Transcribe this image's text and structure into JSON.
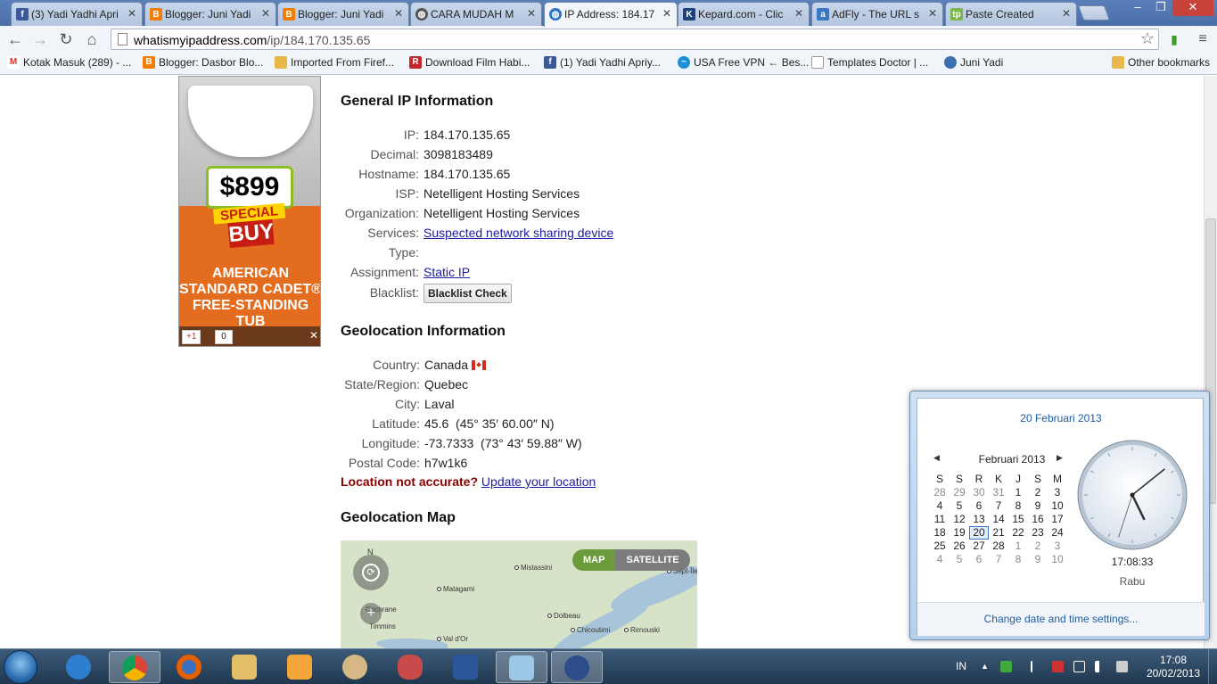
{
  "browser": {
    "tabs": [
      {
        "label": "(3) Yadi Yadhi Apri",
        "favicon": "facebook-icon",
        "color": "#3b5998"
      },
      {
        "label": "Blogger: Juni Yadi",
        "favicon": "blogger-icon",
        "color": "#f57d00"
      },
      {
        "label": "Blogger: Juni Yadi",
        "favicon": "blogger-icon",
        "color": "#f57d00"
      },
      {
        "label": "CARA MUDAH M",
        "favicon": "globe-icon",
        "color": "#555555"
      },
      {
        "label": "IP Address: 184.17",
        "favicon": "globe-icon",
        "color": "#2a74c9"
      },
      {
        "label": "Kepard.com - Clic",
        "favicon": "kepard-icon",
        "color": "#1d3f7a"
      },
      {
        "label": "AdFly - The URL s",
        "favicon": "adfly-icon",
        "color": "#3a78c2"
      },
      {
        "label": "Paste Created",
        "favicon": "paste-icon",
        "color": "#7ab648"
      }
    ],
    "active_tab_index": 4,
    "window_controls": {
      "minimize": "–",
      "restore": "❐",
      "close": "✕"
    },
    "url_host": "whatismyipaddress.com",
    "url_path": "/ip/184.170.135.65",
    "bookmarks": [
      {
        "label": "Kotak Masuk (289) - ...",
        "icon": "gmail-icon",
        "color": "#d93025"
      },
      {
        "label": "Blogger: Dasbor Blo...",
        "icon": "blogger-icon",
        "color": "#f57d00"
      },
      {
        "label": "Imported From Firef...",
        "icon": "folder-icon",
        "color": "#e8b84a"
      },
      {
        "label": "Download Film Habi...",
        "icon": "r-icon",
        "color": "#c0282d"
      },
      {
        "label": "(1) Yadi Yadhi Apriy...",
        "icon": "facebook-icon",
        "color": "#3b5998"
      },
      {
        "label": "USA Free VPN ← Bes...",
        "icon": "vpn-icon",
        "color": "#1f8fd9"
      },
      {
        "label": "Templates Doctor | ...",
        "icon": "page-icon",
        "color": "#dddddd"
      },
      {
        "label": "Juni Yadi",
        "icon": "globe-icon",
        "color": "#3a6fb0"
      }
    ],
    "other_bookmarks": "Other bookmarks"
  },
  "ad": {
    "price": "$899",
    "special": "SPECIAL",
    "buy": "BUY",
    "copy_line1": "AMERICAN",
    "copy_line2": "STANDARD CADET®",
    "copy_line3": "FREE-STANDING",
    "copy_line4": "TUB",
    "plus_one": "+1",
    "count": "0",
    "close": "✕"
  },
  "general": {
    "heading": "General IP Information",
    "ip_label": "IP:",
    "ip": "184.170.135.65",
    "decimal_label": "Decimal:",
    "decimal": "3098183489",
    "hostname_label": "Hostname:",
    "hostname": "184.170.135.65",
    "isp_label": "ISP:",
    "isp": "Netelligent Hosting Services",
    "org_label": "Organization:",
    "org": "Netelligent Hosting Services",
    "services_label": "Services:",
    "services": "Suspected network sharing device",
    "type_label": "Type:",
    "assignment_label": "Assignment:",
    "assignment": "Static IP",
    "blacklist_label": "Blacklist:",
    "blacklist_button": "Blacklist Check"
  },
  "geo": {
    "heading": "Geolocation Information",
    "country_label": "Country:",
    "country": "Canada",
    "state_label": "State/Region:",
    "state": "Quebec",
    "city_label": "City:",
    "city": "Laval",
    "lat_label": "Latitude:",
    "lat": "45.6  (45° 35′ 60.00″ N)",
    "lon_label": "Longitude:",
    "lon": "-73.7333  (73° 43′ 59.88″ W)",
    "postal_label": "Postal Code:",
    "postal": "h7w1k6",
    "not_accurate": "Location not accurate?",
    "update_link": "Update your location"
  },
  "map": {
    "heading": "Geolocation Map",
    "north": "N",
    "map_btn": "MAP",
    "satellite_btn": "SATELLITE",
    "zoom_in": "+",
    "cities": [
      "Mistassini",
      "Matagami",
      "Cochrane",
      "Dolbeau",
      "Chicoutimi",
      "Rimouski",
      "Timmins",
      "Val d'Or",
      "Sept-Îles"
    ]
  },
  "datetime_popup": {
    "date_header": "20 Februari 2013",
    "month": "Februari 2013",
    "prev": "◀",
    "next": "▶",
    "weekdays": [
      "S",
      "S",
      "R",
      "K",
      "J",
      "S",
      "M"
    ],
    "weeks": [
      [
        "28",
        "29",
        "30",
        "31",
        "1",
        "2",
        "3"
      ],
      [
        "4",
        "5",
        "6",
        "7",
        "8",
        "9",
        "10"
      ],
      [
        "11",
        "12",
        "13",
        "14",
        "15",
        "16",
        "17"
      ],
      [
        "18",
        "19",
        "20",
        "21",
        "22",
        "23",
        "24"
      ],
      [
        "25",
        "26",
        "27",
        "28",
        "1",
        "2",
        "3"
      ],
      [
        "4",
        "5",
        "6",
        "7",
        "8",
        "9",
        "10"
      ]
    ],
    "time": "17:08:33",
    "day": "Rabu",
    "settings_link": "Change date and time settings..."
  },
  "taskbar": {
    "apps": [
      "ie-icon",
      "chrome-icon",
      "firefox-icon",
      "explorer-icon",
      "media-player-icon",
      "paint-icon",
      "snipping-tool-icon",
      "word-icon",
      "notepad-icon",
      "app-icon"
    ],
    "active_app_index": 1,
    "language": "IN",
    "time": "17:08",
    "date": "20/02/2013"
  }
}
